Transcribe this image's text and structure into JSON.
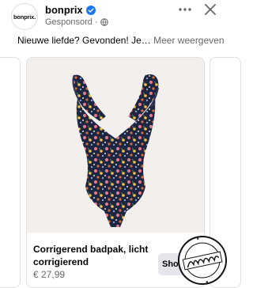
{
  "post": {
    "avatar_text": "bonprix.",
    "page_name": "bonprix",
    "sponsored_label": "Gesponsord",
    "caption": "Nieuwe liefde? Gevonden! Je…",
    "see_more": "Meer weergeven"
  },
  "card": {
    "title": "Corrigerend badpak, licht corrigierend",
    "price": "€ 27,99",
    "button_label": "Shoppen"
  },
  "watermark": {
    "outer_text": "GEREGISTREERD OUDER",
    "main_text": "Hubvouchies",
    "bottom_text": "GOED VOOR OUDERS"
  },
  "icons": [
    "verified-badge-icon",
    "globe-icon",
    "more-options-icon",
    "close-icon"
  ],
  "colors": {
    "verified": "#1877f2",
    "secondary_text": "#65676b",
    "button_bg": "#e4e6eb"
  }
}
